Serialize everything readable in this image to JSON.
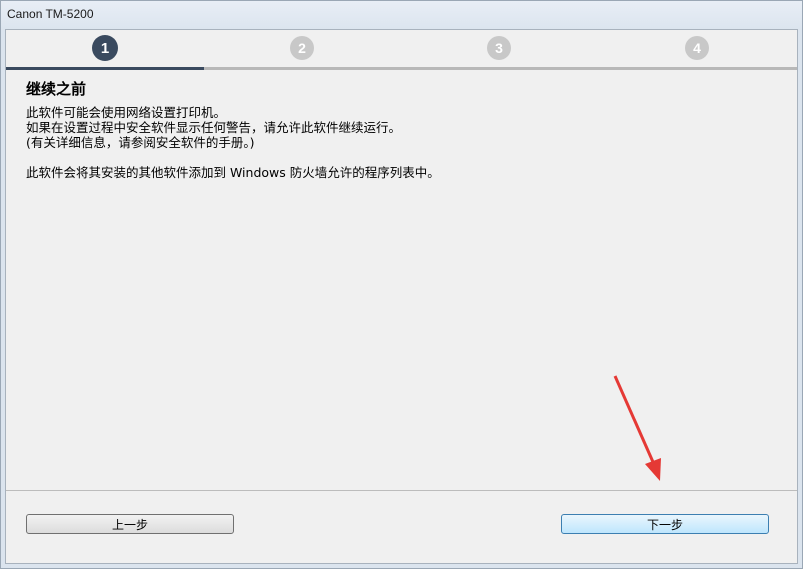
{
  "window": {
    "title": "Canon TM-5200"
  },
  "steps": [
    {
      "label": "1",
      "active": true
    },
    {
      "label": "2",
      "active": false
    },
    {
      "label": "3",
      "active": false
    },
    {
      "label": "4",
      "active": false
    }
  ],
  "progress": {
    "current_step": 1,
    "total_steps": 4
  },
  "content": {
    "heading": "继续之前",
    "lines": [
      "此软件可能会使用网络设置打印机。",
      "如果在设置过程中安全软件显示任何警告，请允许此软件继续运行。",
      "(有关详细信息，请参阅安全软件的手册。)"
    ],
    "note": "此软件会将其安装的其他软件添加到 Windows 防火墙允许的程序列表中。"
  },
  "buttons": {
    "back_label": "上一步",
    "next_label": "下一步"
  },
  "colors": {
    "step_active": "#3a4a5f",
    "step_inactive": "#c8c8c8",
    "annotation_arrow": "#e53935"
  }
}
